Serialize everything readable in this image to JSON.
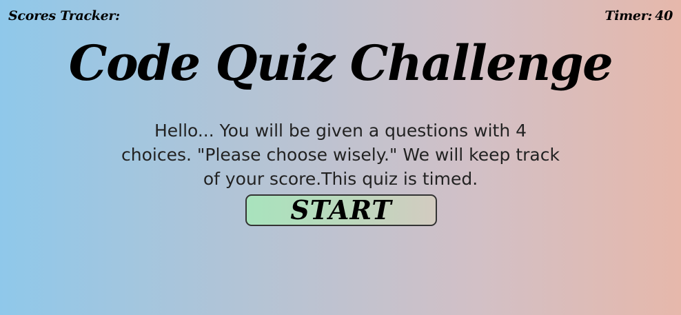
{
  "header": {
    "scores_label": "Scores Tracker:",
    "timer_label": "Timer:",
    "timer_value": "40"
  },
  "main": {
    "title": "Code Quiz Challenge",
    "intro": "Hello... You will be given a questions with 4 choices. \"Please choose wisely.\" We will keep track of your score.This quiz is timed.",
    "start_label": "START"
  },
  "colors": {
    "background_left": "#8fc8ea",
    "background_right": "#e6b8ab",
    "button_left": "#a8e3bd",
    "button_right": "#d3cbc0",
    "text": "#000000"
  }
}
